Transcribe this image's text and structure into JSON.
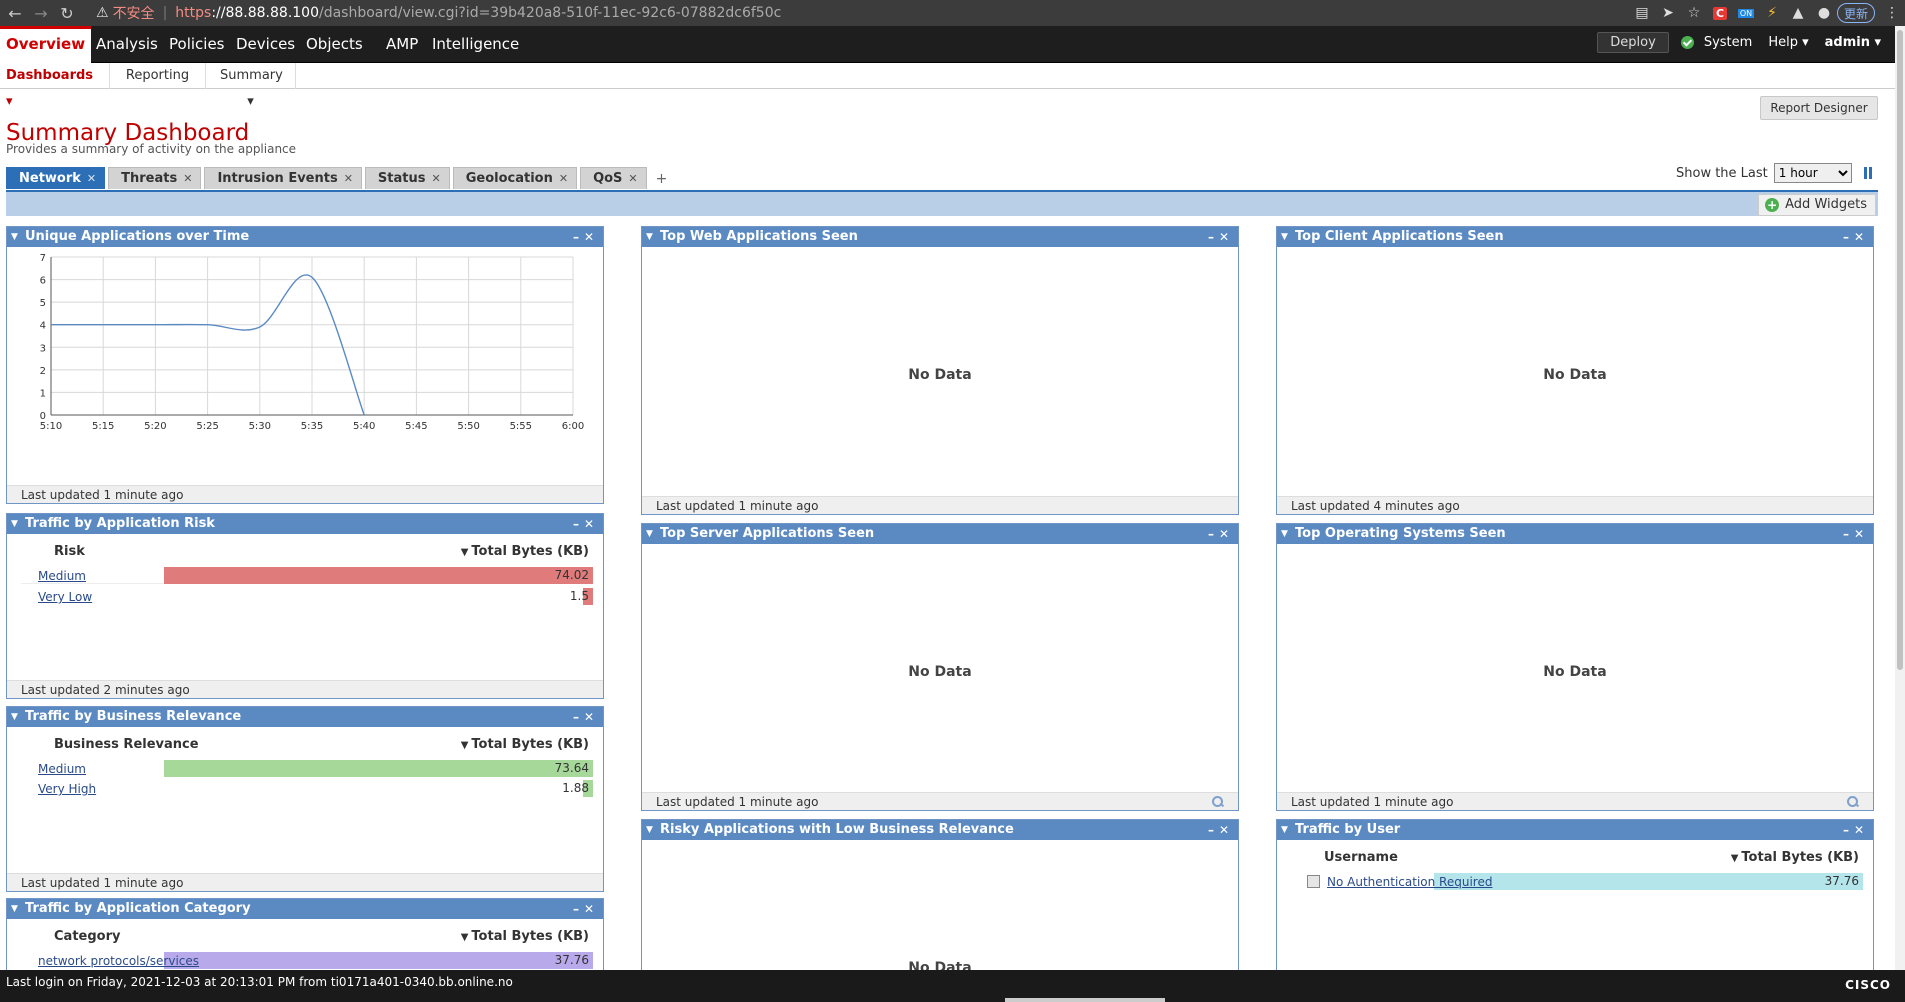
{
  "browser": {
    "insecure_label": "不安全",
    "url_proto": "https",
    "url_host": "://88.88.88.100",
    "url_path": "/dashboard/view.cgi?id=39b420a8-510f-11ec-92c6-07882dc6f50c",
    "update_label": "更新",
    "ext_on_badge": "ON"
  },
  "mainnav": {
    "tabs": [
      "Overview",
      "Analysis",
      "Policies",
      "Devices",
      "Objects",
      "AMP",
      "Intelligence"
    ],
    "deploy": "Deploy",
    "system": "System",
    "help": "Help ▾",
    "admin": "admin ▾"
  },
  "subnav": {
    "tabs": [
      "Dashboards ▾",
      "Reporting",
      "Summary ▾"
    ]
  },
  "page": {
    "title": "Summary Dashboard",
    "subtitle": "Provides a summary of activity on the appliance",
    "report_designer": "Report Designer",
    "show_last_label": "Show the Last",
    "show_last_value": "1 hour",
    "add_widgets": "Add Widgets"
  },
  "dash_tabs": [
    "Network",
    "Threats",
    "Intrusion Events",
    "Status",
    "Geolocation",
    "QoS"
  ],
  "widgets": {
    "unique_apps": {
      "title": "Unique Applications over Time",
      "footer": "Last updated 1 minute ago"
    },
    "app_risk": {
      "title": "Traffic by Application Risk",
      "col1": "Risk",
      "col2": "Total Bytes (KB)",
      "rows": [
        {
          "label": "Medium",
          "value": "74.02",
          "fraction": 1.0
        },
        {
          "label": "Very Low",
          "value": "1.5",
          "fraction": 0.02
        }
      ],
      "color": "#e07b7b",
      "footer": "Last updated 2 minutes ago"
    },
    "business_relevance": {
      "title": "Traffic by Business Relevance",
      "col1": "Business Relevance",
      "col2": "Total Bytes (KB)",
      "rows": [
        {
          "label": "Medium",
          "value": "73.64",
          "fraction": 1.0
        },
        {
          "label": "Very High",
          "value": "1.88",
          "fraction": 0.025
        }
      ],
      "color": "#a6d89a",
      "footer": "Last updated 1 minute ago"
    },
    "app_category": {
      "title": "Traffic by Application Category",
      "col1": "Category",
      "col2": "Total Bytes (KB)",
      "rows": [
        {
          "label": "network protocols/services",
          "value": "37.76",
          "fraction": 1.0
        }
      ],
      "color": "#b8a9ea"
    },
    "top_web": {
      "title": "Top Web Applications Seen",
      "nodata": "No Data",
      "footer": "Last updated 1 minute ago"
    },
    "top_client": {
      "title": "Top Client Applications Seen",
      "nodata": "No Data",
      "footer": "Last updated 4 minutes ago"
    },
    "top_server": {
      "title": "Top Server Applications Seen",
      "nodata": "No Data",
      "footer": "Last updated 1 minute ago"
    },
    "top_os": {
      "title": "Top Operating Systems Seen",
      "nodata": "No Data",
      "footer": "Last updated 1 minute ago"
    },
    "risky_apps": {
      "title": "Risky Applications with Low Business Relevance",
      "nodata": "No Data"
    },
    "traffic_user": {
      "title": "Traffic by User",
      "col1": "Username",
      "col2": "Total Bytes (KB)",
      "rows": [
        {
          "label": "No Authentication Required",
          "value": "37.76",
          "fraction": 1.0
        }
      ],
      "color": "#b3e5ea"
    }
  },
  "chart_data": {
    "type": "line",
    "title": "",
    "x": [
      "5:10",
      "5:15",
      "5:20",
      "5:25",
      "5:30",
      "5:35",
      "5:40",
      "5:45",
      "5:50",
      "5:55",
      "6:00"
    ],
    "series": [
      {
        "values": [
          4,
          4,
          4,
          4,
          3.9,
          6.1,
          0,
          null,
          null,
          null,
          null
        ]
      }
    ],
    "ylim": [
      0,
      7
    ],
    "yticks": [
      0,
      1,
      2,
      3,
      4,
      5,
      6,
      7
    ],
    "grid": true,
    "line_color": "#5b8ac2"
  },
  "footer": {
    "last_login": "Last login on Friday, 2021-12-03 at 20:13:01 PM from ti0171a401-0340.bb.online.no",
    "brand": "CISCO"
  }
}
